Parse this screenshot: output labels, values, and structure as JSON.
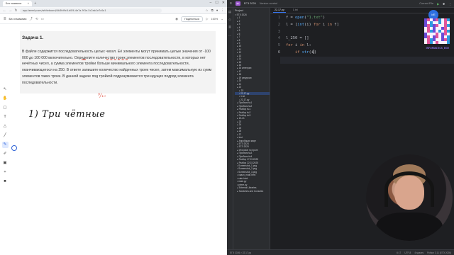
{
  "browser": {
    "tabs": [
      {
        "label": "Без названия"
      }
    ],
    "url": "app.teemlycom/whiteboard/4b3fd9c8-d0f4-4e7a-9f1e-5c2ab1e7c0a1",
    "doc_title": "Без названия",
    "share_label": "Поделиться",
    "zoom": "160%"
  },
  "task": {
    "title": "Задача 1.",
    "body": "В файле содержится последовательность целых чисел. Её элементы могут принимать целые значения от -100 000 до 100 000 включительно. Определите количество троек элементов последовательности, в которых нет нечётных чисел, а сумма элементов тройки больше минимального элемента последовательности, оканчивающегося на 250. В ответе запишите количество найденных троек чисел, затем максимальную из сумм элементов таких троек. В данной задаче под тройкой подразумевается три идущих подряд элемента последовательности."
  },
  "annotations": {
    "handwriting": "1) Три чётные",
    "red_mark": "⁹/₁₀"
  },
  "ide": {
    "project_label": "Project",
    "project_name": "ЕГЭ 2026",
    "vcs": "Version control",
    "run_config": "Current File",
    "tabs": [
      {
        "label": "22.17.py"
      },
      {
        "label": "1.txt"
      }
    ],
    "tree_root": "ЕГЭ 2026",
    "tree": [
      "1",
      "2",
      "3",
      "4",
      "5",
      "6",
      "7",
      "8",
      "9",
      "10",
      "11",
      "12",
      "13",
      "14",
      "15",
      "16",
      "16 интеграл",
      "17",
      "18",
      "19 рекурсия",
      "20",
      "21",
      "22",
      "23",
      "22.17.py",
      "1.txt",
      "22.17.py",
      "Пробник №1",
      "Пробник №2",
      "Разбор №1",
      "Разбор №2",
      "Разбор №3",
      "19-21",
      "23",
      "24",
      "25",
      "26",
      "27",
      "test",
      "Апробация март",
      "ЕГЭ 2024",
      "ЕГЭ 2025",
      "Итоговое по проге",
      "Пробник №3",
      "Пробник №4",
      "Разбор 17.03.2025",
      "Разбор 22.03.2025",
      "Screenshot_1.png",
      "Screenshot_2.png",
      "Screenshot_3.png",
      "vaacn_main.html",
      "catn.html",
      "main.py",
      "prime.py",
      "External Libraries",
      "Scratches and Consoles"
    ],
    "line_numbers": [
      "1",
      "2",
      "3",
      "4",
      "5",
      "6"
    ],
    "status_path": "ЕГЭ 2026 > 22.17.py",
    "status_pos": "6:17",
    "status_encoding": "UTF-8",
    "status_indent": "4 spaces",
    "status_python": "Python 3.11 (ЕГЭ 2026)"
  },
  "brand": {
    "caption": "INFORMATICS_EGE"
  }
}
